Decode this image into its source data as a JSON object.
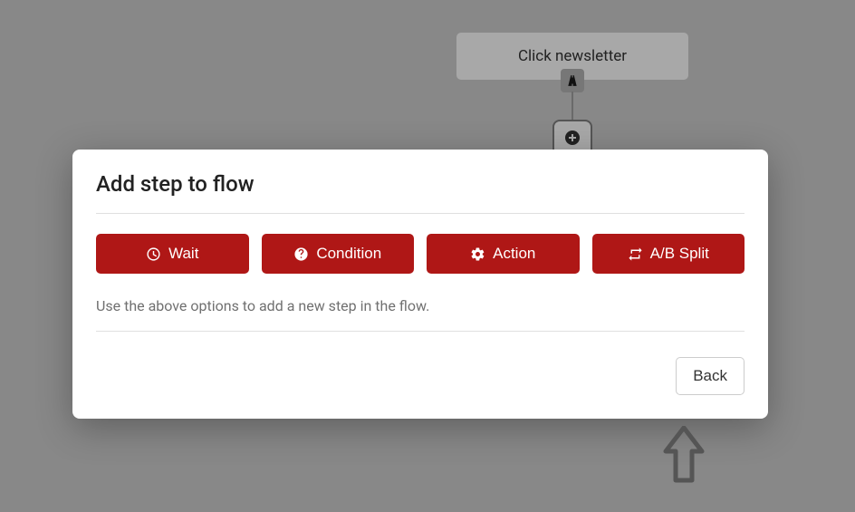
{
  "flow": {
    "node_label": "Click newsletter"
  },
  "modal": {
    "title": "Add step to flow",
    "buttons": {
      "wait": "Wait",
      "condition": "Condition",
      "action": "Action",
      "ab_split": "A/B Split"
    },
    "help_text": "Use the above options to add a new step in the flow.",
    "back_label": "Back"
  }
}
